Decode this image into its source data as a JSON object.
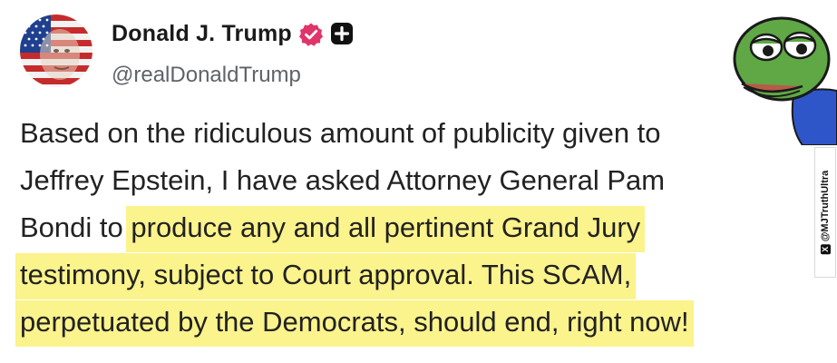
{
  "post": {
    "author": {
      "display_name": "Donald J. Trump",
      "handle": "@realDonaldTrump",
      "verified_badge_icon": "verified-check-icon",
      "extra_badge_icon": "plus-badge-icon",
      "verified_color": "#e0356b"
    },
    "body": {
      "line1": "Based on the ridiculous amount of publicity given to",
      "line2": "Jeffrey Epstein, I have asked Attorney General Pam",
      "line3_plain": "Bondi to ",
      "line3_highlight": "produce any and all pertinent Grand Jury",
      "line4_highlight": "testimony, subject to Court approval. This SCAM,",
      "line5_highlight": "perpetuated by the Democrats, should end, right now!"
    },
    "highlight_color": "#fbf38c"
  },
  "watermark": {
    "text": "@MJTruthUltra",
    "icon": "x-logo-icon"
  },
  "sticker": {
    "icon": "pepe-frog-sticker-icon"
  }
}
